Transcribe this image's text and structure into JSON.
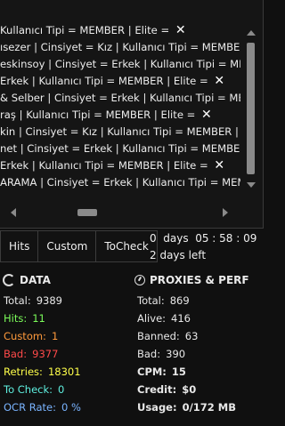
{
  "log": {
    "lines": [
      {
        "text": "Kullanıcı Tipi = MEMBER | Elite = ",
        "mark": "✕"
      },
      {
        "text": "ısezer | Cinsiyet = Kız | Kullanıcı Tipi = MEMBER | El",
        "mark": ""
      },
      {
        "text": "eskinsoy | Cinsiyet = Erkek | Kullanıcı Tipi = MEMBE",
        "mark": ""
      },
      {
        "text": "Erkek | Kullanıcı Tipi = MEMBER | Elite = ",
        "mark": "✕"
      },
      {
        "text": "& Selber | Cinsiyet = Erkek | Kullanıcı Tipi = MEMB",
        "mark": ""
      },
      {
        "text": "raş | Kullanıcı Tipi = MEMBER | Elite = ",
        "mark": "✕"
      },
      {
        "text": "kin | Cinsiyet = Kız | Kullanıcı Tipi = MEMBER | Elite",
        "mark": ""
      },
      {
        "text": "net | Cinsiyet = Erkek | Kullanıcı Tipi = MEMBER | Elite",
        "mark": ""
      },
      {
        "text": "Erkek | Kullanıcı Tipi = MEMBER | Elite = ",
        "mark": "✕"
      },
      {
        "text": "ARAMA | Cinsiyet = Erkek | Kullanıcı Tipi = MEMBER",
        "mark": ""
      }
    ]
  },
  "tabs": [
    "Hits",
    "Custom",
    "ToCheck"
  ],
  "timer": {
    "elapsed": "0  days  05 : 58 : 09",
    "left": "2 days left"
  },
  "data_section": {
    "title": "DATA",
    "rows": [
      {
        "label": "Total:",
        "value": "9389",
        "color": "#e8e8e8"
      },
      {
        "label": "Hits:",
        "value": "11",
        "color": "#7cfc5a"
      },
      {
        "label": "Custom:",
        "value": "1",
        "color": "#ff9a3c"
      },
      {
        "label": "Bad:",
        "value": "9377",
        "color": "#ff4a4a"
      },
      {
        "label": "Retries:",
        "value": "18301",
        "color": "#ffff4a"
      },
      {
        "label": "To Check:",
        "value": "0",
        "color": "#5ff0e0"
      },
      {
        "label": "OCR Rate:",
        "value": "0 %",
        "color": "#7ab4ff"
      }
    ]
  },
  "proxies_section": {
    "title": "PROXIES & PERF",
    "rows": [
      {
        "label": "Total:",
        "value": "869",
        "bold": false
      },
      {
        "label": "Alive:",
        "value": "416",
        "bold": false
      },
      {
        "label": "Banned:",
        "value": "63",
        "bold": false
      },
      {
        "label": "Bad:",
        "value": "390",
        "bold": false
      },
      {
        "label": "CPM:",
        "value": "15",
        "bold": true
      },
      {
        "label": "Credit:",
        "value": "$0",
        "bold": true
      },
      {
        "label": "Usage:",
        "value": "0/172 MB",
        "bold": true
      }
    ]
  }
}
